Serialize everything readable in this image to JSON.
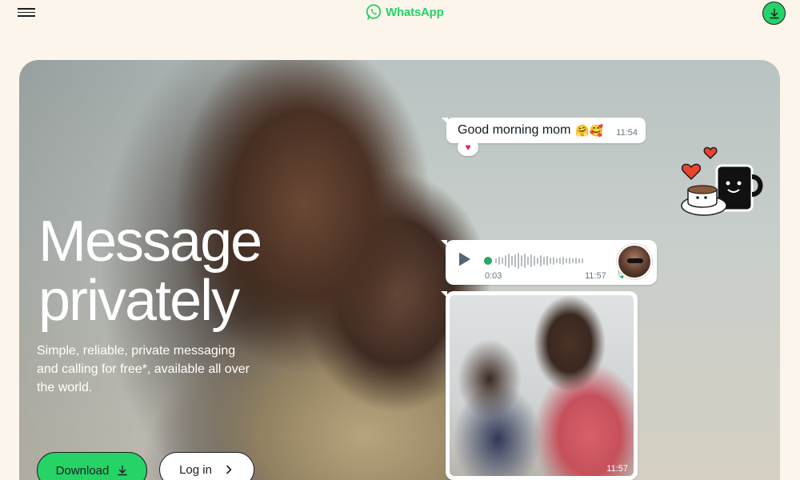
{
  "nav": {
    "brand": "WhatsApp",
    "menu_icon": "hamburger-menu-icon",
    "download_icon": "download-icon"
  },
  "hero": {
    "title_line1": "Message",
    "title_line2": "privately",
    "subtitle": "Simple, reliable, private messaging and calling for free*, available all over the world.",
    "download_label": "Download",
    "login_label": "Log in"
  },
  "chat": {
    "message_text": "Good morning mom",
    "message_emojis": "🤗🥰",
    "message_time": "11:54",
    "reaction": "♥",
    "voice_elapsed": "0:03",
    "voice_time": "11:57",
    "photo_time": "11:57"
  },
  "colors": {
    "brand_green": "#25d366",
    "page_bg": "#fcf5eb"
  }
}
